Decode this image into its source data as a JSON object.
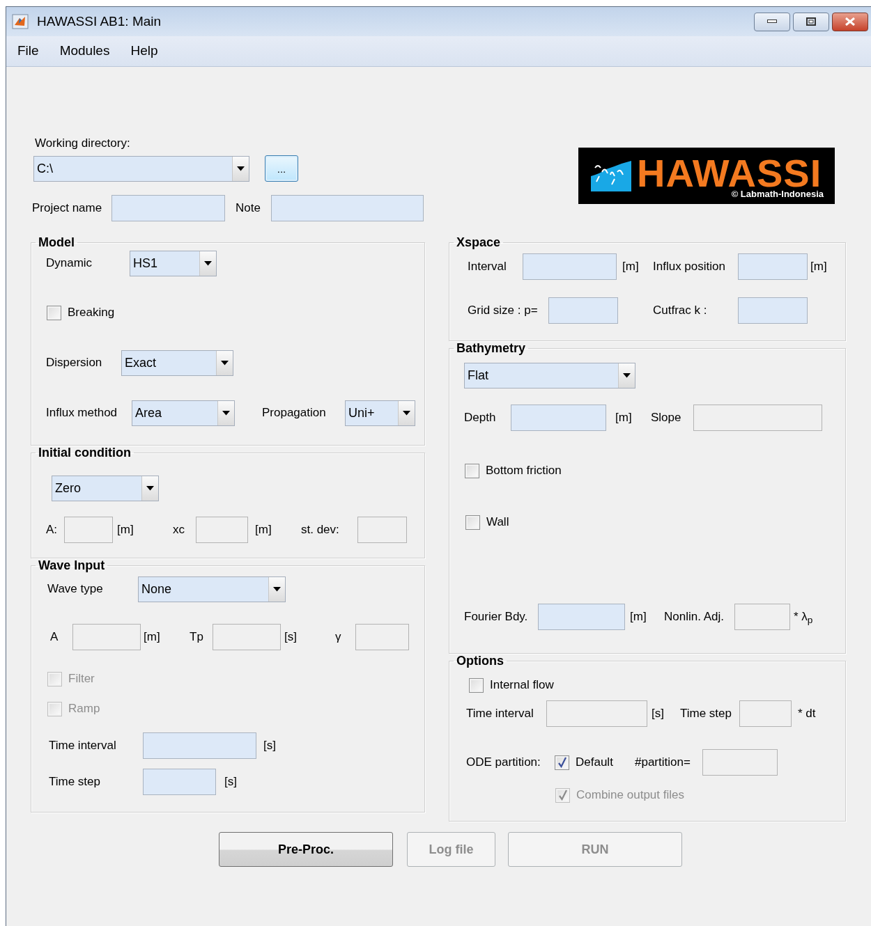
{
  "window": {
    "title": "HAWASSI AB1: Main"
  },
  "menu": [
    {
      "label": "File"
    },
    {
      "label": "Modules"
    },
    {
      "label": "Help"
    }
  ],
  "working_directory": {
    "label": "Working directory:",
    "value": "C:\\",
    "browse_button": "..."
  },
  "logo": {
    "title": "HAWASSI",
    "caption": "© Labmath-Indonesia"
  },
  "project_name": {
    "label": "Project name",
    "disabled": false
  },
  "note": {
    "label": "Note",
    "disabled": false
  },
  "model": {
    "title": "Model",
    "dynamic": {
      "label": "Dynamic",
      "value": "HS1"
    },
    "breaking": {
      "label": "Breaking",
      "checked": false,
      "disabled": false
    },
    "dispersion": {
      "label": "Dispersion",
      "value": "Exact"
    },
    "influx_method": {
      "label": "Influx method",
      "value": "Area"
    },
    "propagation": {
      "label": "Propagation",
      "value": "Uni+"
    }
  },
  "initial_condition": {
    "title": "Initial condition",
    "type": {
      "value": "Zero"
    },
    "a": {
      "label": "A:",
      "unit": "[m]",
      "disabled": true
    },
    "xc": {
      "label": "xc",
      "unit": "[m]",
      "disabled": true
    },
    "st_dev": {
      "label": "st. dev:",
      "disabled": true
    }
  },
  "wave_input": {
    "title": "Wave Input",
    "wave_type": {
      "label": "Wave type",
      "value": "None"
    },
    "a": {
      "label": "A",
      "unit": "[m]",
      "disabled": true
    },
    "tp": {
      "label": "Tp",
      "unit": "[s]",
      "disabled": true
    },
    "gamma": {
      "label": "γ",
      "disabled": true
    },
    "filter": {
      "label": "Filter",
      "checked": false,
      "disabled": true
    },
    "ramp": {
      "label": "Ramp",
      "checked": false,
      "disabled": true
    },
    "time_interval": {
      "label": "Time interval",
      "unit": "[s]",
      "disabled": false
    },
    "time_step": {
      "label": "Time step",
      "unit": "[s]",
      "disabled": false
    }
  },
  "xspace": {
    "title": "Xspace",
    "interval": {
      "label": "Interval",
      "unit": "[m]",
      "disabled": false
    },
    "influx_position": {
      "label": "Influx position",
      "unit": "[m]",
      "disabled": false
    },
    "grid_size": {
      "label": "Grid size : p=",
      "disabled": false
    },
    "cutfrac": {
      "label": "Cutfrac k :",
      "disabled": false
    }
  },
  "bathymetry": {
    "title": "Bathymetry",
    "type": {
      "value": "Flat"
    },
    "depth": {
      "label": "Depth",
      "unit": "[m]",
      "disabled": false
    },
    "slope": {
      "label": "Slope",
      "disabled": true
    },
    "bottom_friction": {
      "label": "Bottom friction",
      "checked": false,
      "disabled": false
    },
    "wall": {
      "label": "Wall",
      "checked": false,
      "disabled": false
    },
    "fourier_bdy": {
      "label": "Fourier Bdy.",
      "unit": "[m]",
      "disabled": false
    },
    "nonlin_adj": {
      "label": "Nonlin. Adj.",
      "unit": "* λ$_{p}$",
      "disabled": true
    }
  },
  "options": {
    "title": "Options",
    "internal_flow": {
      "label": "Internal flow",
      "checked": false,
      "disabled": false
    },
    "time_interval": {
      "label": "Time interval",
      "unit": "[s]",
      "disabled": true
    },
    "time_step": {
      "label": "Time step",
      "unit": "* dt",
      "disabled": true
    },
    "ode_partition": {
      "label": "ODE partition:"
    },
    "default": {
      "label": "Default",
      "checked": true,
      "disabled": false
    },
    "partition": {
      "label": "#partition=",
      "disabled": true
    },
    "combine_output": {
      "label": "Combine output files",
      "checked": true,
      "disabled": true
    }
  },
  "buttons": [
    {
      "label": "Pre-Proc.",
      "disabled": false
    },
    {
      "label": "Log file",
      "disabled": true
    },
    {
      "label": "RUN",
      "disabled": true
    }
  ]
}
